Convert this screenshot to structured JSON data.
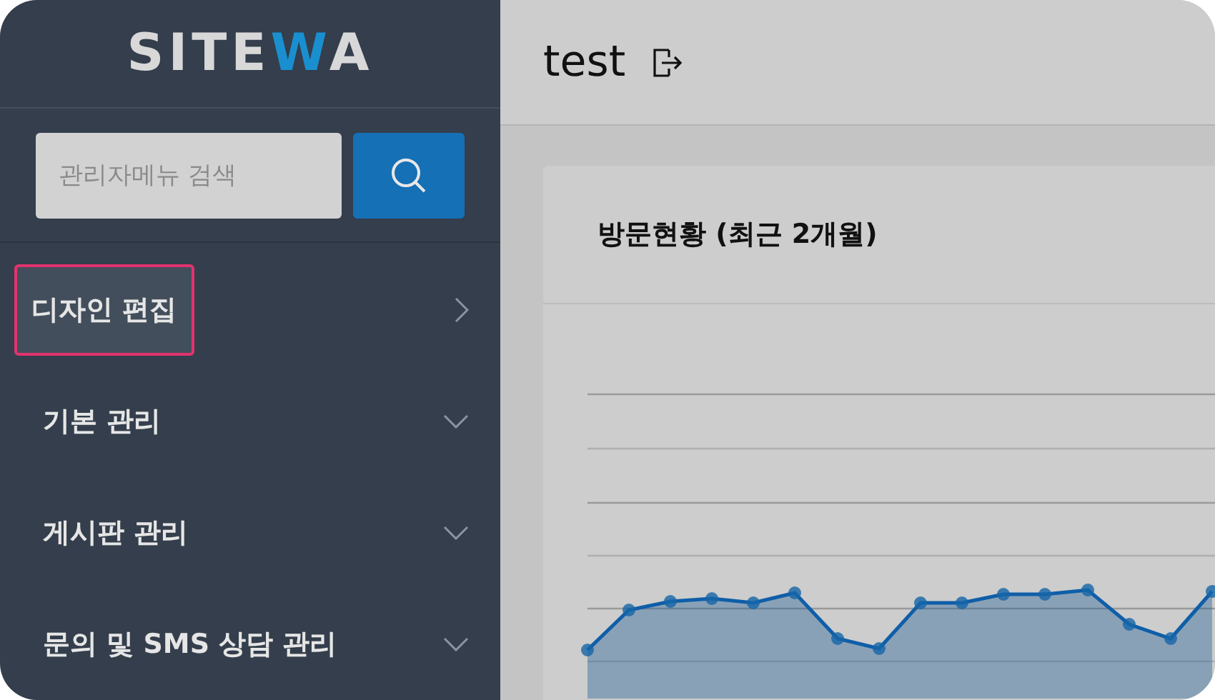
{
  "sidebar": {
    "logo": {
      "text": "SITE",
      "accent": "W",
      "rest": "A"
    },
    "search": {
      "placeholder": "관리자메뉴 검색"
    },
    "items": [
      {
        "label": "디자인 편집",
        "kind": "link",
        "selected": true
      },
      {
        "label": "기본 관리",
        "kind": "group",
        "selected": false
      },
      {
        "label": "게시판 관리",
        "kind": "group",
        "selected": false
      },
      {
        "label": "문의 및 SMS 상담 관리",
        "kind": "group",
        "selected": false
      }
    ]
  },
  "header": {
    "title": "test"
  },
  "card": {
    "title": "방문현황 (최근 2개월)"
  }
}
